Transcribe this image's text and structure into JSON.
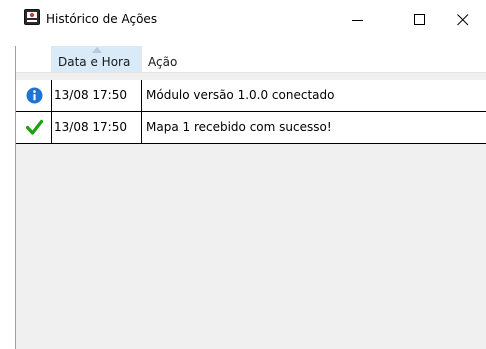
{
  "window": {
    "title": "Histórico de Ações",
    "icon": "app-icon",
    "controls": [
      "minimize-icon",
      "maximize-icon",
      "close-icon"
    ]
  },
  "table": {
    "columns": [
      "",
      "Data e Hora",
      "Ação"
    ],
    "sorted_column": "Data e Hora",
    "rows": [
      {
        "icon": "info-icon",
        "date": "13/08 17:50",
        "action": "Módulo versão 1.0.0 conectado"
      },
      {
        "icon": "checkmark-icon",
        "date": "13/08 17:50",
        "action": "Mapa 1 recebido com sucesso!"
      }
    ]
  },
  "colors": {
    "info": "#1e73d4",
    "success": "#18a30a",
    "sorted_header": "#d9ebf9"
  }
}
